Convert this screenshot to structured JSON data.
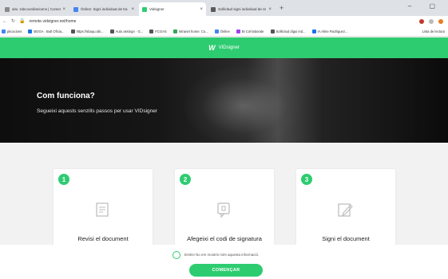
{
  "browser": {
    "tabs": [
      {
        "title": "aitu :rdecoordineicens | Comer",
        "color": "#8a8a8a"
      },
      {
        "title": "Ònline: Signi individuat de tra",
        "color": "#4285f4"
      },
      {
        "title": "Vidsigner",
        "color": "#2ecc71"
      },
      {
        "title": "Sollicitud signi individual de re",
        "color": "#5a5a5a"
      }
    ],
    "new_tab": "+",
    "window_controls": "– ▢",
    "url": "remote.vidsigner.net/home",
    "bookmarks": [
      {
        "label": "plicacions",
        "color": "#4285f4"
      },
      {
        "label": "BOGA · Butl Oficia...",
        "color": "#1a73e8"
      },
      {
        "label": "https://sbaqu.ids...",
        "color": "#555555"
      },
      {
        "label": "Auto assingn · G...",
        "color": "#555555"
      },
      {
        "label": "FCGAS",
        "color": "#555555"
      },
      {
        "label": "Intranet home: Co...",
        "color": "#34a853"
      },
      {
        "label": "Ònline",
        "color": "#4285f4"
      },
      {
        "label": "Bi Col·laborate",
        "color": "#a142f4"
      },
      {
        "label": "Sollicitud digui ind...",
        "color": "#555555"
      },
      {
        "label": "IA Alme Rodriguez...",
        "color": "#1a73e8"
      }
    ],
    "bookmarks_right": "Lista de lectura"
  },
  "app": {
    "logo_mark": "W",
    "logo_text": "VIDsigner"
  },
  "hero": {
    "title": "Com funciona?",
    "subtitle": "Segueixi aquests senzills passos per usar VIDsigner"
  },
  "steps": [
    {
      "number": "1",
      "label": "Revisi el document",
      "icon": "document-icon"
    },
    {
      "number": "2",
      "label": "Afegeixi el codi de signatura",
      "icon": "sms-code-icon"
    },
    {
      "number": "3",
      "label": "Signi el document",
      "icon": "pen-edit-icon"
    }
  ],
  "footer": {
    "checkbox_label": "Entès! No em mostris més aquesta informació.",
    "start_button": "COMENÇAR"
  },
  "colors": {
    "brand": "#2ecc71"
  }
}
